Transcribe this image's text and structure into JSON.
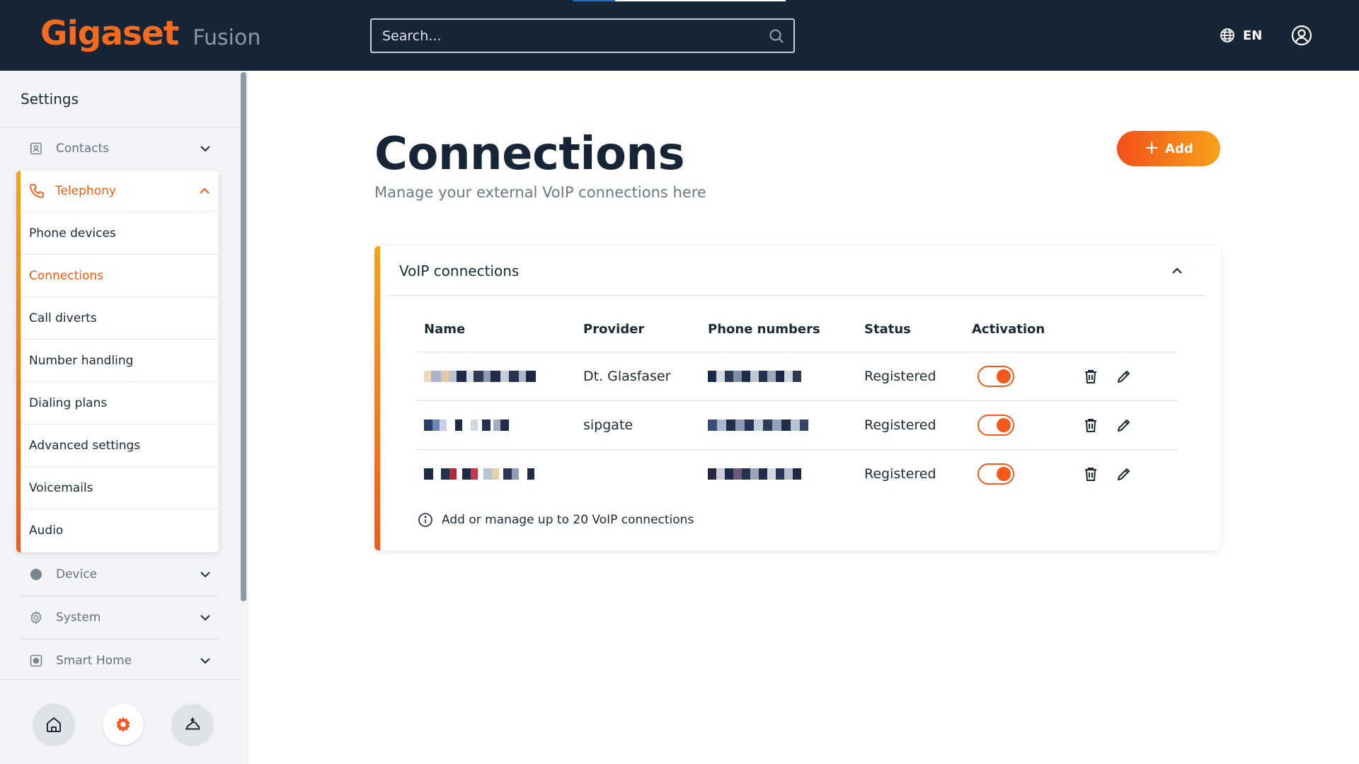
{
  "header": {
    "logo": "Gigaset",
    "product": "Fusion",
    "search_placeholder": "Search...",
    "language": "EN"
  },
  "sidebar": {
    "title": "Settings",
    "groups": [
      {
        "label": "Contacts",
        "icon": "contacts-icon"
      },
      {
        "label": "Telephony",
        "icon": "phone-icon"
      },
      {
        "label": "Device",
        "icon": "device-icon"
      },
      {
        "label": "System",
        "icon": "gear-icon"
      },
      {
        "label": "Smart Home",
        "icon": "smart-home-icon"
      }
    ],
    "telephony_items": [
      {
        "label": "Phone devices"
      },
      {
        "label": "Connections"
      },
      {
        "label": "Call diverts"
      },
      {
        "label": "Number handling"
      },
      {
        "label": "Dialing plans"
      },
      {
        "label": "Advanced settings"
      },
      {
        "label": "Voicemails"
      },
      {
        "label": "Audio"
      }
    ],
    "active_item": "Connections",
    "dock": [
      "home-icon",
      "settings-gear-icon",
      "cloud-user-icon"
    ]
  },
  "main": {
    "title": "Connections",
    "subtitle": "Manage your external VoIP connections here",
    "add_label": "Add",
    "card": {
      "title": "VoIP connections",
      "columns": [
        "Name",
        "Provider",
        "Phone numbers",
        "Status",
        "Activation"
      ],
      "rows": [
        {
          "provider": "Dt. Glasfaser",
          "status": "Registered",
          "active": true
        },
        {
          "provider": "sipgate",
          "status": "Registered",
          "active": true
        },
        {
          "provider": "",
          "status": "Registered",
          "active": true
        }
      ],
      "info": "Add or manage up to 20 VoIP connections"
    }
  },
  "colors": {
    "header_bg": "#172636",
    "accent": "#f35a1a",
    "accent_gradient_end": "#f7a21a",
    "sidebar_bg": "#f2f4f7"
  }
}
